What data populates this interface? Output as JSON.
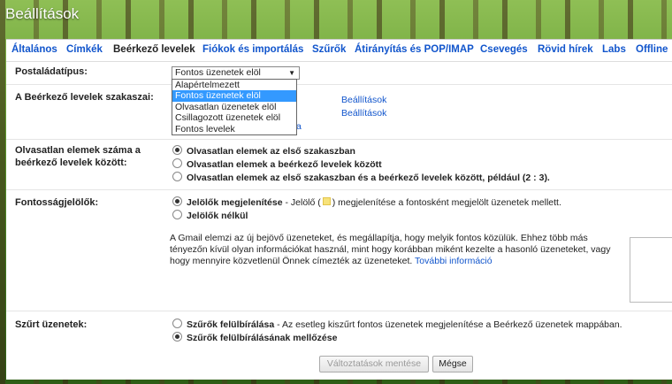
{
  "window": {
    "title": "Beállítások"
  },
  "tabs": [
    {
      "label": "Általános"
    },
    {
      "label": "Címkék"
    },
    {
      "label": "Beérkező levelek"
    },
    {
      "label": "Fiókok és importálás"
    },
    {
      "label": "Szűrők"
    },
    {
      "label": "Átirányítás és POP/IMAP"
    },
    {
      "label": "Csevegés"
    },
    {
      "label": "Rövid hírek"
    },
    {
      "label": "Labs"
    },
    {
      "label": "Offline"
    }
  ],
  "mailbox_type": {
    "label": "Postaládatípus:",
    "selected": "Fontos üzenetek elöl",
    "options": [
      "Alapértelmezett",
      "Fontos üzenetek elöl",
      "Olvasatlan üzenetek elöl",
      "Csillagozott üzenetek elöl",
      "Fontos levelek"
    ]
  },
  "sections": {
    "label": "A Beérkező levelek szakaszai:",
    "settings_link_1": "Beállítások",
    "settings_link_2": "Beállítások",
    "partial_link": "a"
  },
  "unread_count": {
    "label": "Olvasatlan elemek száma a beérkező levelek között:",
    "options": [
      "Olvasatlan elemek az első szakaszban",
      "Olvasatlan elemek a beérkező levelek között",
      "Olvasatlan elemek az első szakaszban és a beérkező levelek között, például (2 : 3)."
    ],
    "selected_index": 0
  },
  "importance": {
    "label": "Fontosságjelölők:",
    "option1_bold": "Jelölők megjelenítése",
    "option1_rest_a": " - Jelölő (",
    "option1_rest_b": ") megjelenítése a fontosként megjelölt üzenetek mellett.",
    "option2": "Jelölők nélkül",
    "selected_index": 0,
    "description": "A Gmail elemzi az új bejövő üzeneteket, és megállapítja, hogy melyik fontos közülük. Ehhez több más tényezőn kívül olyan információkat használ, mint hogy korábban miként kezelte a hasonló üzeneteket, vagy hogy mennyire közvetlenül Önnek címezték az üzeneteket.",
    "more_link": "További információ"
  },
  "filtered": {
    "label": "Szűrt üzenetek:",
    "option1_bold": "Szűrők felülbírálása",
    "option1_rest": " - Az esetleg kiszűrt fontos üzenetek megjelenítése a Beérkező üzenetek mappában.",
    "option2": "Szűrők felülbírálásának mellőzése",
    "selected_index": 1
  },
  "buttons": {
    "save": "Változtatások mentése",
    "cancel": "Mégse"
  }
}
